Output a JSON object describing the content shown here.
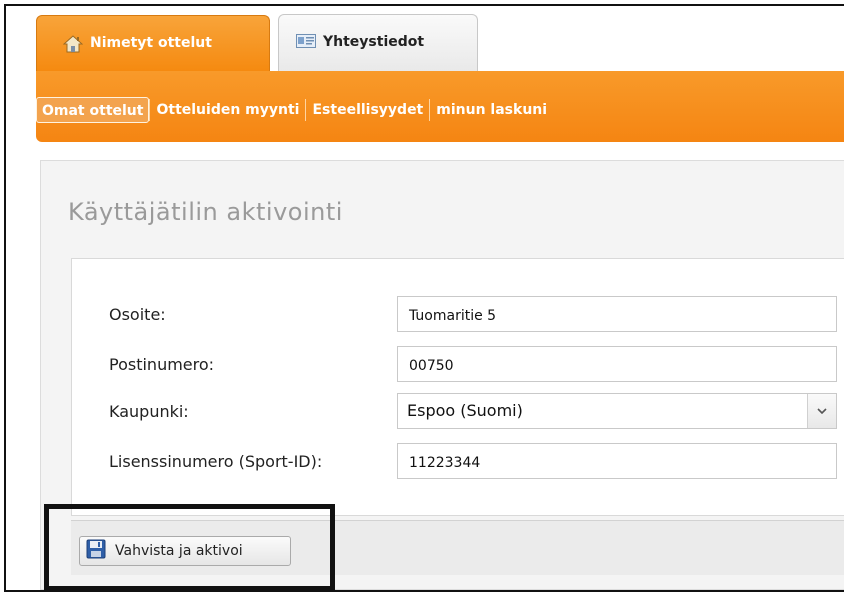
{
  "tabs": [
    {
      "label": "Nimetyt ottelut",
      "icon": "house-icon",
      "active": true
    },
    {
      "label": "Yhteystiedot",
      "icon": "contact-card-icon",
      "active": false
    }
  ],
  "subnav": {
    "items": [
      {
        "label": "Omat ottelut",
        "active": true
      },
      {
        "label": "Otteluiden myynti",
        "active": false
      },
      {
        "label": "Esteellisyydet",
        "active": false
      },
      {
        "label": "minun laskuni",
        "active": false
      }
    ]
  },
  "page": {
    "title": "Käyttäjätilin aktivointi"
  },
  "form": {
    "address": {
      "label": "Osoite:",
      "value": "Tuomaritie 5"
    },
    "postcode": {
      "label": "Postinumero:",
      "value": "00750"
    },
    "city": {
      "label": "Kaupunki:",
      "value": "Espoo (Suomi)"
    },
    "license": {
      "label": "Lisenssinumero (Sport-ID):",
      "value": "11223344"
    }
  },
  "footer": {
    "button_label": "Vahvista ja aktivoi",
    "button_icon": "floppy-disk-icon"
  },
  "colors": {
    "accent": "#f58a10",
    "title_gray": "#9a9a9a"
  }
}
